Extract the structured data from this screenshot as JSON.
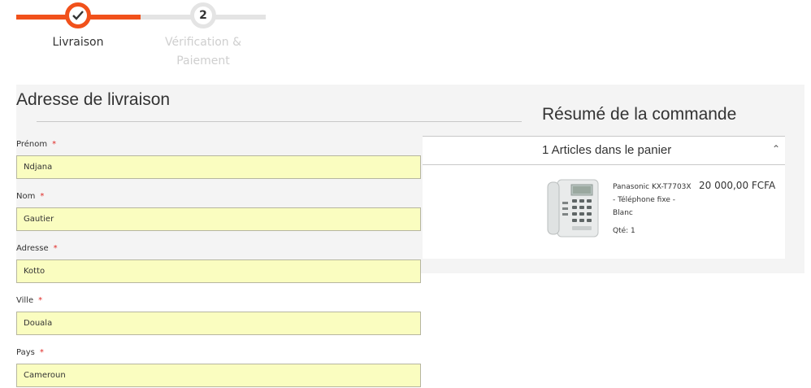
{
  "progress": {
    "steps": [
      {
        "label": "Livraison",
        "state": "complete"
      },
      {
        "number": "2",
        "label": "Vérification & Paiement",
        "state": "pending"
      }
    ],
    "colors": {
      "active": "#f1511b",
      "inactive": "#e4e4e4"
    }
  },
  "shipping": {
    "title": "Adresse de livraison",
    "required_marker": "*",
    "fields": [
      {
        "label": "Prénom",
        "value": "Ndjana"
      },
      {
        "label": "Nom",
        "value": "Gautier"
      },
      {
        "label": "Adresse",
        "value": "Kotto"
      },
      {
        "label": "Ville",
        "value": "Douala"
      },
      {
        "label": "Pays",
        "value": "Cameroun"
      }
    ]
  },
  "summary": {
    "title": "Résumé de la commande",
    "cart_toggle": "1 Articles dans le panier",
    "item": {
      "name": "Panasonic KX-T7703X - Téléphone fixe - Blanc",
      "price": "20 000,00 FCFA",
      "qty": "Qté: 1"
    }
  }
}
